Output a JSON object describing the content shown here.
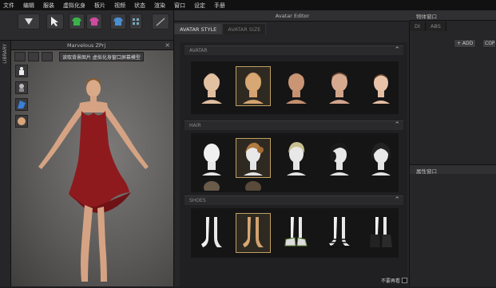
{
  "menubar": {
    "items": [
      "文件",
      "编辑",
      "服装",
      "虚拟化身",
      "板片",
      "视频",
      "状态",
      "渲染",
      "窗口",
      "设定",
      "手册"
    ]
  },
  "viewport": {
    "title": "Marvelous ZPrj",
    "texture_button": "读取背景图片 虚拟化身窗口屏幕模型",
    "close": "×"
  },
  "left_strip": {
    "label": "LIBRARY"
  },
  "editor": {
    "title": "Avatar Editor",
    "tabs": [
      {
        "label": "AVATAR STYLE",
        "active": true
      },
      {
        "label": "AVATAR SIZE",
        "active": false
      }
    ],
    "sections": [
      {
        "label": "AVATAR",
        "collapse": "⌃"
      },
      {
        "label": "HAIR",
        "collapse": "⌃"
      },
      {
        "label": "SHOES",
        "collapse": "⌃"
      }
    ]
  },
  "right_panel": {
    "title": "物体窗口",
    "tabs": [
      "DI",
      "ABS"
    ],
    "add": "+ ADD",
    "add2": "COP",
    "lower_title": "属性窗口"
  },
  "footer": {
    "checkbox_label": "不要再看"
  },
  "colors": {
    "accent_selected": "#c0a060",
    "dress": "#8e1a1e"
  }
}
